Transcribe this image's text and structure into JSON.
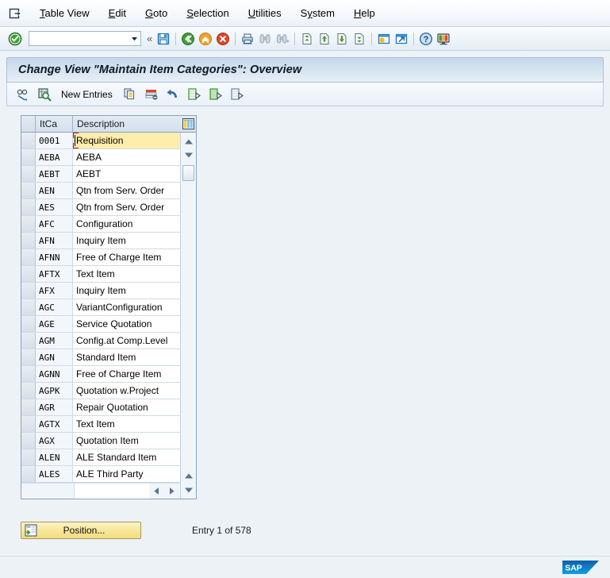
{
  "window": {
    "icon": "window-menu-icon"
  },
  "menubar": {
    "items": [
      {
        "label": "Table View",
        "accel": "T"
      },
      {
        "label": "Edit",
        "accel": "E"
      },
      {
        "label": "Goto",
        "accel": "G"
      },
      {
        "label": "Selection",
        "accel": "S"
      },
      {
        "label": "Utilities",
        "accel": "U"
      },
      {
        "label": "System",
        "accel": "y"
      },
      {
        "label": "Help",
        "accel": "H"
      }
    ]
  },
  "system_toolbar": {
    "enter_icon": "green-check-icon",
    "command_field": {
      "value": "",
      "placeholder": ""
    },
    "dropdown_icon": "chevron-down-icon",
    "collapse_icon": "double-chevron-left-icon",
    "buttons": [
      {
        "name": "save-button",
        "icon": "floppy-disk-icon"
      },
      {
        "name": "back-button",
        "icon": "green-back-arrow-icon"
      },
      {
        "name": "exit-button",
        "icon": "orange-up-arrow-icon"
      },
      {
        "name": "cancel-button",
        "icon": "red-x-icon"
      },
      {
        "name": "print-button",
        "icon": "printer-icon"
      },
      {
        "name": "find-button",
        "icon": "binoculars-icon"
      },
      {
        "name": "find-next-button",
        "icon": "binoculars-plus-icon"
      },
      {
        "name": "first-page-button",
        "icon": "first-page-icon"
      },
      {
        "name": "previous-page-button",
        "icon": "previous-page-icon"
      },
      {
        "name": "next-page-button",
        "icon": "next-page-icon"
      },
      {
        "name": "last-page-button",
        "icon": "last-page-icon"
      },
      {
        "name": "create-session-button",
        "icon": "new-session-icon"
      },
      {
        "name": "create-shortcut-button",
        "icon": "shortcut-icon"
      },
      {
        "name": "help-button",
        "icon": "question-mark-icon"
      },
      {
        "name": "customize-layout-button",
        "icon": "monitor-icon"
      }
    ]
  },
  "title": {
    "text": "Change View \"Maintain Item Categories\": Overview"
  },
  "app_toolbar": {
    "buttons": [
      {
        "name": "display-change-button",
        "icon": "glasses-pencil-icon",
        "label": ""
      },
      {
        "name": "check-entries-button",
        "icon": "magnifier-table-icon",
        "label": ""
      },
      {
        "name": "new-entries-button",
        "icon": "",
        "label": "New Entries"
      },
      {
        "name": "copy-as-button",
        "icon": "copy-icon",
        "label": ""
      },
      {
        "name": "delete-button",
        "icon": "delete-row-icon",
        "label": ""
      },
      {
        "name": "undo-button",
        "icon": "undo-arrow-icon",
        "label": ""
      },
      {
        "name": "select-all-button",
        "icon": "select-all-icon",
        "label": ""
      },
      {
        "name": "select-block-button",
        "icon": "select-block-icon",
        "label": ""
      },
      {
        "name": "deselect-all-button",
        "icon": "deselect-all-icon",
        "label": ""
      }
    ]
  },
  "grid": {
    "columns": [
      {
        "key": "itca",
        "label": "ItCa"
      },
      {
        "key": "description",
        "label": "Description"
      }
    ],
    "config_icon": "table-settings-icon",
    "selected_row_index": 0,
    "rows": [
      {
        "itca": "0001",
        "description": "Requisition"
      },
      {
        "itca": "AEBA",
        "description": "AEBA"
      },
      {
        "itca": "AEBT",
        "description": "AEBT"
      },
      {
        "itca": "AEN",
        "description": "Qtn from Serv. Order"
      },
      {
        "itca": "AES",
        "description": "Qtn from Serv. Order"
      },
      {
        "itca": "AFC",
        "description": "Configuration"
      },
      {
        "itca": "AFN",
        "description": "Inquiry Item"
      },
      {
        "itca": "AFNN",
        "description": "Free of Charge Item"
      },
      {
        "itca": "AFTX",
        "description": "Text Item"
      },
      {
        "itca": "AFX",
        "description": "Inquiry Item"
      },
      {
        "itca": "AGC",
        "description": "VariantConfiguration"
      },
      {
        "itca": "AGE",
        "description": "Service Quotation"
      },
      {
        "itca": "AGM",
        "description": "Config.at Comp.Level"
      },
      {
        "itca": "AGN",
        "description": "Standard Item"
      },
      {
        "itca": "AGNN",
        "description": "Free of Charge Item"
      },
      {
        "itca": "AGPK",
        "description": "Quotation w.Project"
      },
      {
        "itca": "AGR",
        "description": "Repair Quotation"
      },
      {
        "itca": "AGTX",
        "description": "Text Item"
      },
      {
        "itca": "AGX",
        "description": "Quotation Item"
      },
      {
        "itca": "ALEN",
        "description": "ALE Standard Item"
      },
      {
        "itca": "ALES",
        "description": "ALE Third Party"
      }
    ],
    "vertical_scrollbar": {
      "up_icon": "scroll-up-icon",
      "down_icon": "scroll-down-icon",
      "bottom_up_icon": "scroll-up-icon",
      "bottom_down_icon": "scroll-down-icon"
    },
    "horizontal_scrollbar": {
      "left_icon": "scroll-left-icon",
      "right_icon": "scroll-right-icon"
    }
  },
  "footer": {
    "position_button": {
      "label": "Position...",
      "icon": "position-icon"
    },
    "entry_status": "Entry 1 of 578"
  },
  "statusbar": {
    "logo": "sap-logo"
  },
  "colors": {
    "selection_yellow": "#ffedab",
    "focus_red": "#d0021b",
    "sap_blue": "#0f6fc0",
    "title_blue": "#c3d7ea",
    "button_yellow": "#f6e79a"
  }
}
